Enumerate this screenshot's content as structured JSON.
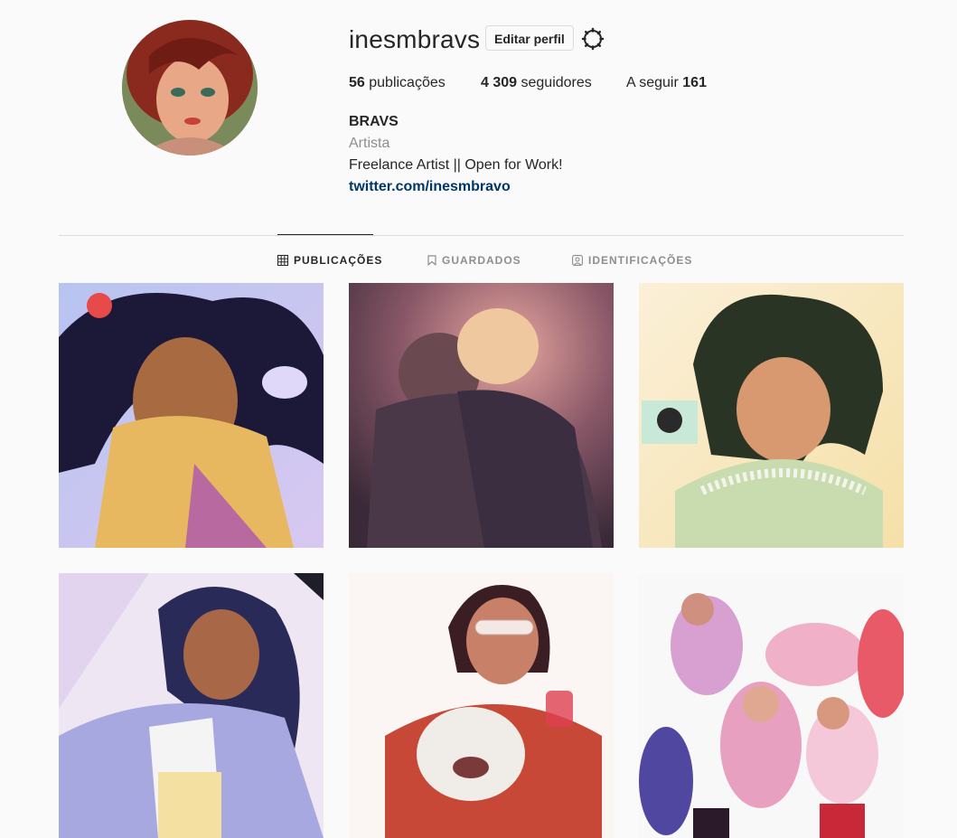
{
  "profile": {
    "username": "inesmbravs",
    "edit_label": "Editar perfil",
    "stats": {
      "posts_count": "56",
      "posts_label": "publicações",
      "followers_count": "4 309",
      "followers_label": "seguidores",
      "following_label": "A seguir",
      "following_count": "161"
    },
    "bio": {
      "name": "BRAVS",
      "category": "Artista",
      "text": "Freelance Artist || Open for Work!",
      "link": "twitter.com/inesmbravo"
    }
  },
  "tabs": [
    {
      "label": "PUBLICAÇÕES",
      "icon": "grid-icon",
      "active": true
    },
    {
      "label": "GUARDADOS",
      "icon": "bookmark-icon",
      "active": false
    },
    {
      "label": "IDENTIFICAÇÕES",
      "icon": "tagged-user-icon",
      "active": false
    }
  ],
  "colors": {
    "background": "#fafafa",
    "text": "#262626",
    "muted": "#8e8e8e",
    "link": "#00376b",
    "border": "#dbdbdb"
  }
}
